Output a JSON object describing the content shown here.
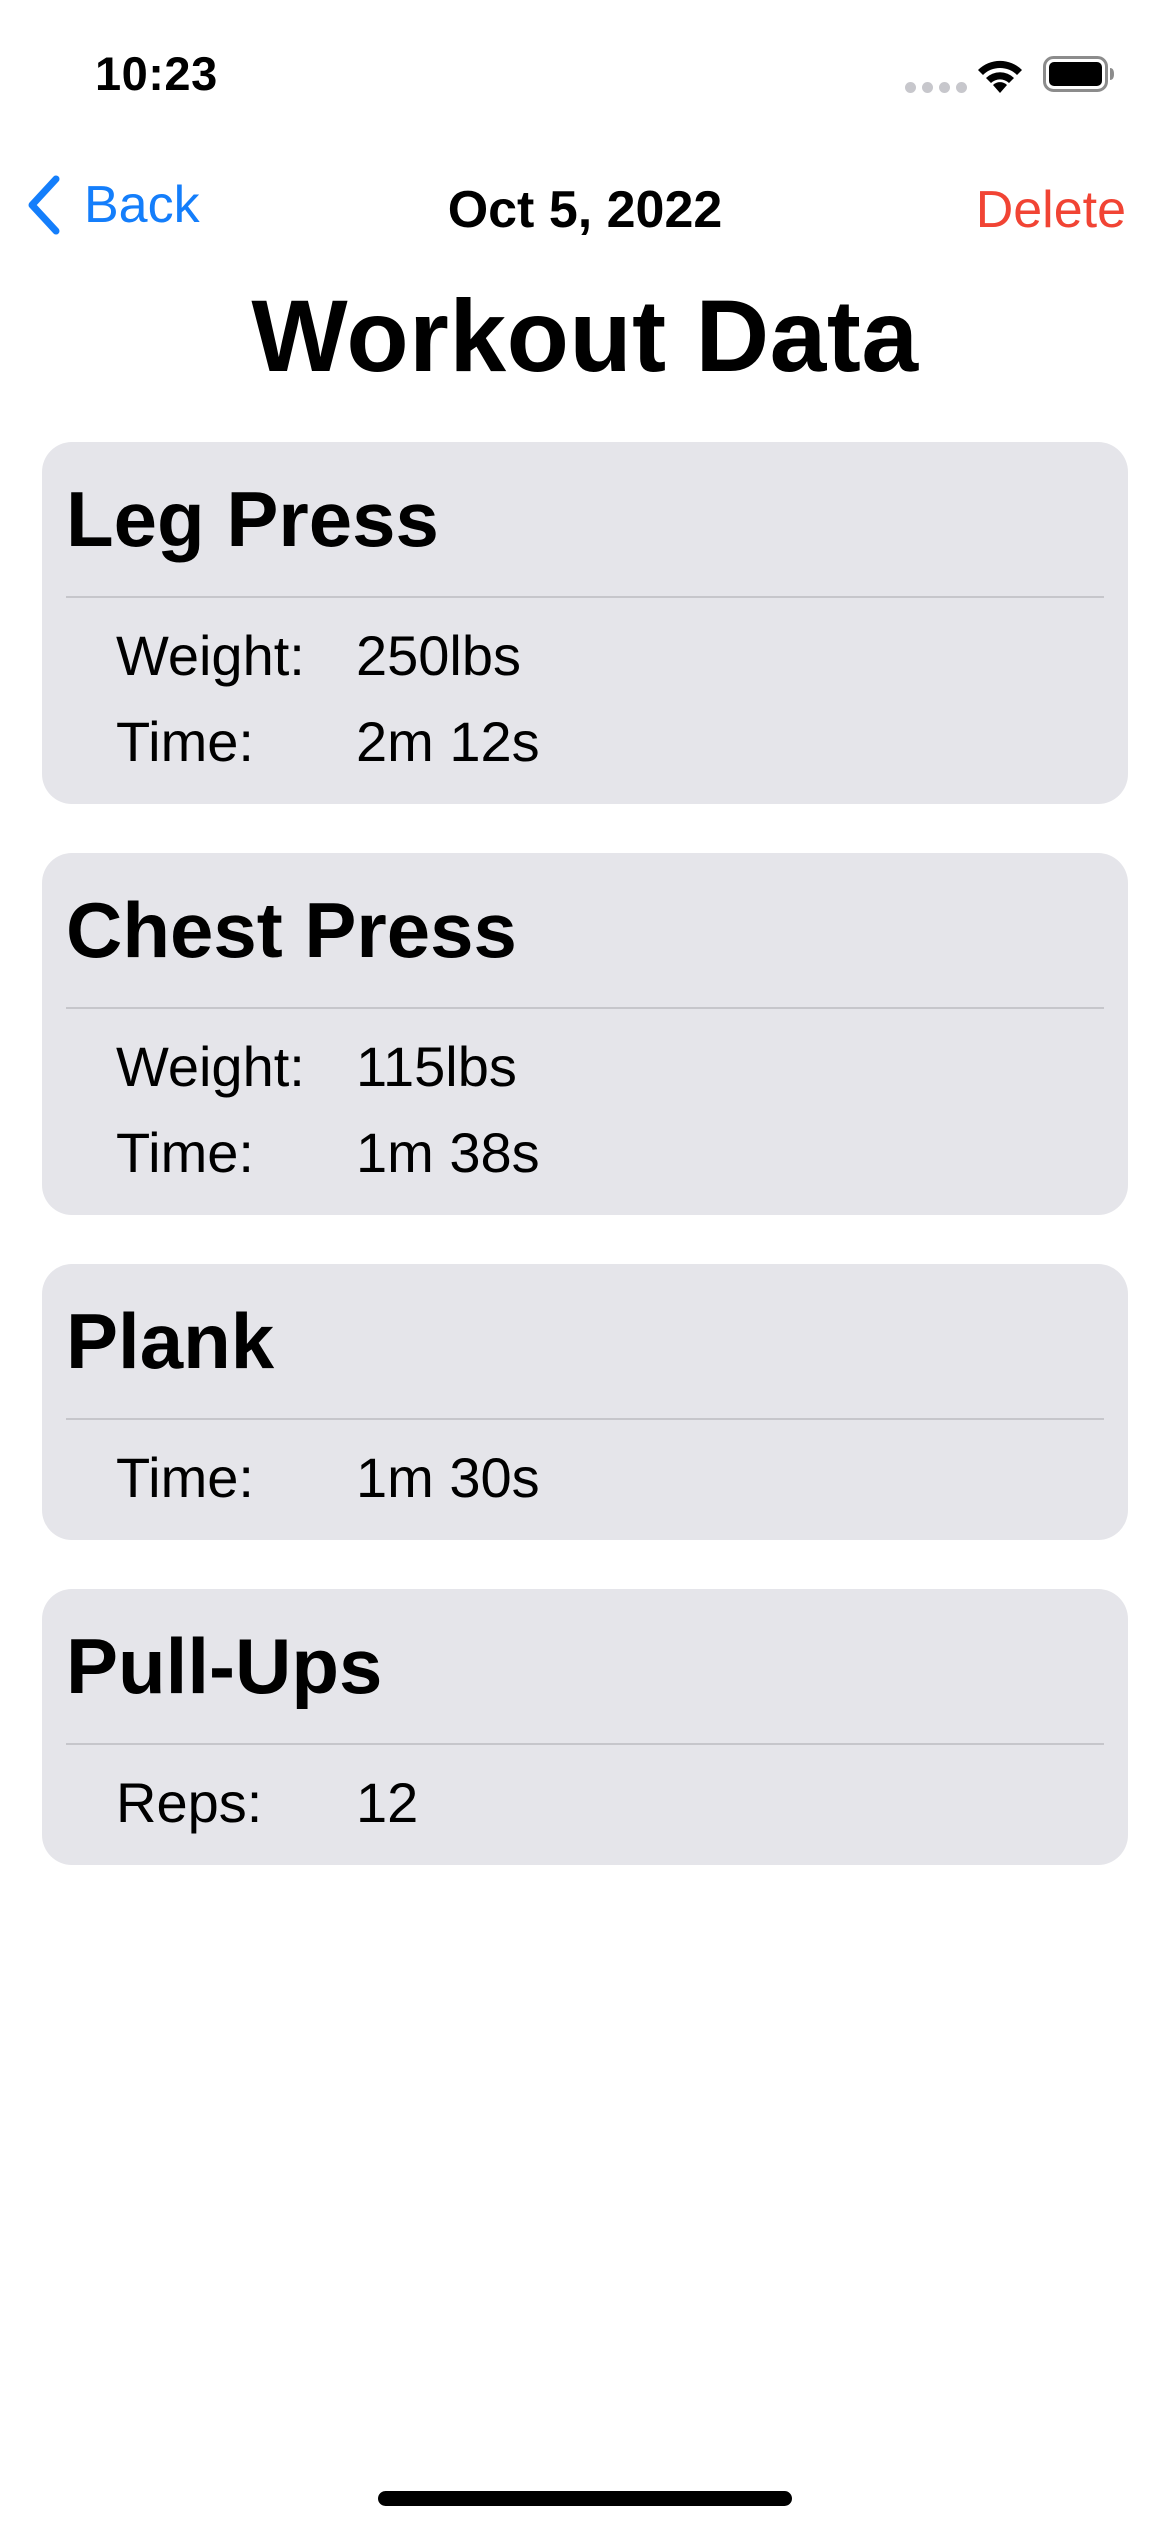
{
  "status_bar": {
    "time": "10:23"
  },
  "nav": {
    "back_label": "Back",
    "title": "Oct 5, 2022",
    "delete_label": "Delete"
  },
  "page": {
    "title": "Workout Data"
  },
  "colors": {
    "accent_blue": "#147EFB",
    "destructive_red": "#F14434",
    "card_background": "#E5E5EA"
  },
  "workouts": [
    {
      "name": "Leg Press",
      "stats": [
        {
          "label": "Weight:",
          "value": "250lbs"
        },
        {
          "label": "Time:",
          "value": "2m 12s"
        }
      ]
    },
    {
      "name": "Chest Press",
      "stats": [
        {
          "label": "Weight:",
          "value": "115lbs"
        },
        {
          "label": "Time:",
          "value": "1m 38s"
        }
      ]
    },
    {
      "name": "Plank",
      "stats": [
        {
          "label": "Time:",
          "value": "1m 30s"
        }
      ]
    },
    {
      "name": "Pull-Ups",
      "stats": [
        {
          "label": "Reps:",
          "value": "12"
        }
      ]
    }
  ]
}
